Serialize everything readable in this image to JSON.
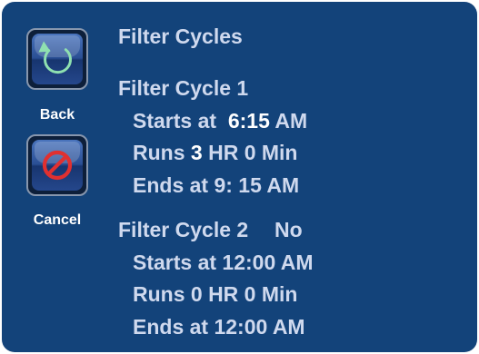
{
  "sidebar": {
    "back": {
      "label": "Back",
      "icon": "back-arrow-icon"
    },
    "cancel": {
      "label": "Cancel",
      "icon": "cancel-icon"
    }
  },
  "title": "Filter Cycles",
  "cycle1": {
    "heading": "Filter Cycle 1",
    "starts_prefix": "Starts at",
    "starts_time": "6:15",
    "starts_ampm": "AM",
    "runs_prefix": "Runs",
    "runs_hours": "3",
    "runs_suffix": "HR 0 Min",
    "ends": "Ends at 9: 15 AM"
  },
  "cycle2": {
    "heading": "Filter Cycle 2",
    "enabled": "No",
    "starts": "Starts at 12:00 AM",
    "runs": "Runs 0 HR 0 Min",
    "ends": "Ends at 12:00 AM"
  },
  "colors": {
    "panel": "#13437a",
    "text": "#cfd9ee",
    "highlight": "#ffffff",
    "back_arrow": "#8fe0b0",
    "cancel_symbol": "#e03030"
  }
}
